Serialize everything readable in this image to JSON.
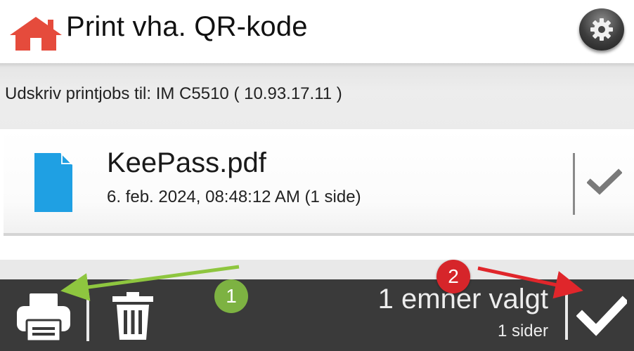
{
  "header": {
    "title": "Print vha. QR-kode",
    "home_icon": "home-icon",
    "settings_icon": "gear-icon",
    "brand_color": "#e54b3c"
  },
  "section": {
    "printer_label": "Udskriv printjobs til: IM C5510 ( 10.93.17.11 )"
  },
  "files": [
    {
      "name": "KeePass.pdf",
      "meta": "6. feb. 2024, 08:48:12 AM (1 side)",
      "icon": "pdf-file-icon",
      "icon_color": "#1fa0e3",
      "selected": true
    }
  ],
  "toolbar": {
    "selection_count": "1 emner valgt",
    "page_count": "1 sider",
    "print_icon": "printer-icon",
    "delete_icon": "trash-icon",
    "confirm_icon": "checkmark-icon",
    "background": "#3a3a3a"
  },
  "annotations": {
    "badge_1": "1",
    "badge_2": "2",
    "badge_1_color": "#7db242",
    "badge_2_color": "#d6252a"
  }
}
